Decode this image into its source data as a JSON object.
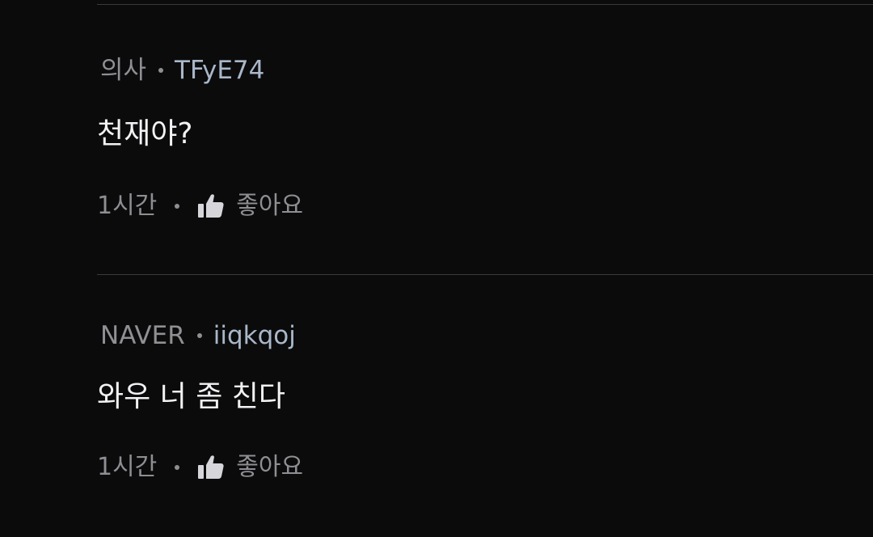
{
  "colors": {
    "background": "#0b0b0c",
    "divider": "#3a3a3c",
    "meta_role": "#8f8f94",
    "meta_user": "#a9b7c8",
    "body_text": "#f2f2f4",
    "footer_text": "#8e8e93"
  },
  "comments": [
    {
      "role": "의사",
      "user": "TFyE74",
      "text": "천재야?",
      "time": "1시간",
      "like_icon": "thumbs-up-icon",
      "like_label": "좋아요"
    },
    {
      "role": "NAVER",
      "user": "iiqkqoj",
      "text": "와우 너 좀 친다",
      "time": "1시간",
      "like_icon": "thumbs-up-icon",
      "like_label": "좋아요"
    }
  ]
}
